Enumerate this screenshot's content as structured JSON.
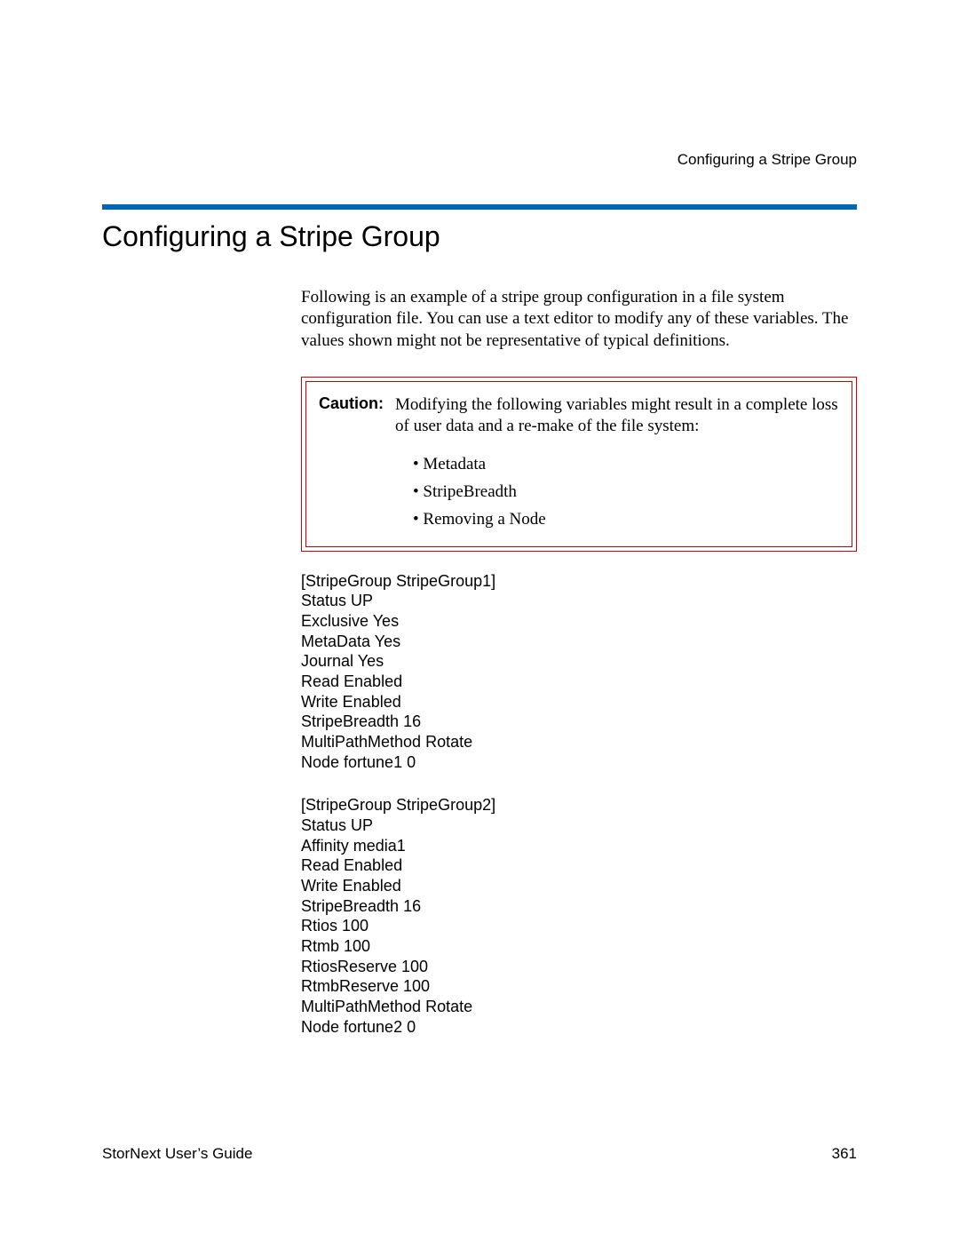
{
  "header": {
    "running": "Configuring a Stripe Group"
  },
  "title": "Configuring a Stripe Group",
  "intro": "Following is an example of a stripe group configuration in a file system configuration file. You can use a text editor to modify any of these variables. The values shown might not be representative of typical definitions.",
  "caution": {
    "label": "Caution:",
    "text": "Modifying the following variables might result in a complete loss of user data and a re-make of the file system:",
    "items": [
      "Metadata",
      "StripeBreadth",
      "Removing a Node"
    ]
  },
  "config1": "[StripeGroup StripeGroup1]\nStatus UP\nExclusive Yes\nMetaData Yes\nJournal Yes\nRead Enabled\nWrite Enabled\nStripeBreadth 16\nMultiPathMethod Rotate\nNode fortune1 0",
  "config2": "[StripeGroup StripeGroup2]\nStatus UP\nAffinity media1\nRead Enabled\nWrite Enabled\nStripeBreadth 16\nRtios 100\nRtmb 100\nRtiosReserve 100\nRtmbReserve 100\nMultiPathMethod Rotate\nNode fortune2 0",
  "footer": {
    "left": "StorNext User’s Guide",
    "right": "361"
  }
}
